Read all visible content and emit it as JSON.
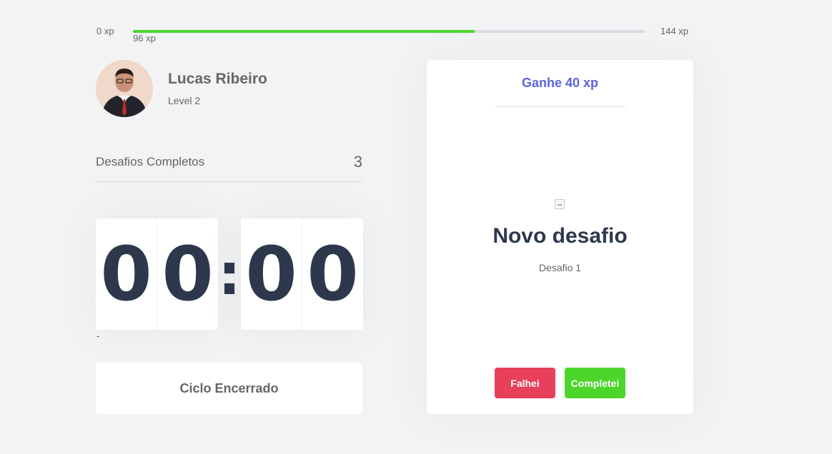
{
  "xp_bar": {
    "min_label": "0 xp",
    "max_label": "144 xp",
    "current_label": "96 xp",
    "progress_percent": 66.7,
    "fill_color": "#4cd62b"
  },
  "profile": {
    "name": "Lucas Ribeiro",
    "level_label": "Level 2"
  },
  "challenges": {
    "label": "Desafios Completos",
    "count": "3"
  },
  "countdown": {
    "minutes": [
      "0",
      "0"
    ],
    "seconds": [
      "0",
      "0"
    ],
    "separator": ":",
    "note": "-"
  },
  "cycle_button": {
    "label": "Ciclo Encerrado"
  },
  "challenge_card": {
    "header": "Ganhe 40 xp",
    "header_color": "#5965e0",
    "title": "Novo desafio",
    "description": "Desafio 1",
    "fail_label": "Falhei",
    "fail_color": "#e83f5b",
    "complete_label": "Completei",
    "complete_color": "#4cd62b"
  }
}
